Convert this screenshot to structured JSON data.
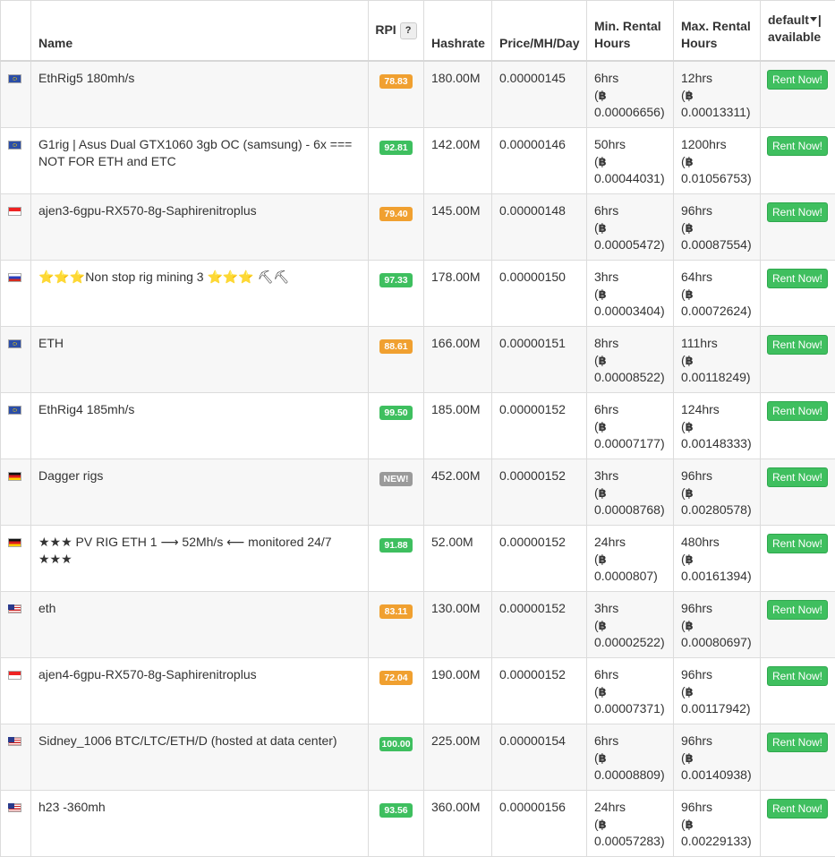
{
  "header": {
    "name": "Name",
    "rpi": "RPI",
    "rpi_help": "?",
    "hashrate": "Hashrate",
    "price": "Price/MH/Day",
    "min_rental": "Min. Rental Hours",
    "max_rental": "Max. Rental Hours",
    "avail_default": "default",
    "avail_available": "| available"
  },
  "btc_symbol": "฿",
  "rent_label": "Rent Now!",
  "colors": {
    "rpi_orange": "#f0a030",
    "rpi_green": "#3ebf5f",
    "rpi_new": "#9a9a9a",
    "rent_button": "#3fbf5f"
  },
  "rows": [
    {
      "flag": "eu",
      "name": "EthRig5 180mh/s",
      "rpi": "78.83",
      "rpi_color": "orange",
      "hashrate": "180.00M",
      "price": "0.00000145",
      "min_hours": "6hrs",
      "min_btc": "0.00006656)",
      "max_hours": "12hrs",
      "max_btc": "0.00013311)"
    },
    {
      "flag": "eu",
      "name": "G1rig | Asus Dual GTX1060 3gb OC (samsung) - 6x === NOT FOR ETH and ETC",
      "rpi": "92.81",
      "rpi_color": "green",
      "hashrate": "142.00M",
      "price": "0.00000146",
      "min_hours": "50hrs",
      "min_btc": "0.00044031)",
      "max_hours": "1200hrs",
      "max_btc": "0.01056753)"
    },
    {
      "flag": "sg",
      "name": "ajen3-6gpu-RX570-8g-Saphirenitroplus",
      "rpi": "79.40",
      "rpi_color": "orange",
      "hashrate": "145.00M",
      "price": "0.00000148",
      "min_hours": "6hrs",
      "min_btc": "0.00005472)",
      "max_hours": "96hrs",
      "max_btc": "0.00087554)"
    },
    {
      "flag": "ru",
      "name": "⭐⭐⭐Non stop rig mining 3 ⭐⭐⭐ ⛏⛏",
      "rpi": "97.33",
      "rpi_color": "green",
      "hashrate": "178.00M",
      "price": "0.00000150",
      "min_hours": "3hrs",
      "min_btc": "0.00003404)",
      "max_hours": "64hrs",
      "max_btc": "0.00072624)"
    },
    {
      "flag": "eu",
      "name": "ETH",
      "rpi": "88.61",
      "rpi_color": "orange",
      "hashrate": "166.00M",
      "price": "0.00000151",
      "min_hours": "8hrs",
      "min_btc": "0.00008522)",
      "max_hours": "111hrs",
      "max_btc": "0.00118249)"
    },
    {
      "flag": "eu",
      "name": "EthRig4 185mh/s",
      "rpi": "99.50",
      "rpi_color": "green",
      "hashrate": "185.00M",
      "price": "0.00000152",
      "min_hours": "6hrs",
      "min_btc": "0.00007177)",
      "max_hours": "124hrs",
      "max_btc": "0.00148333)"
    },
    {
      "flag": "de",
      "name": "Dagger rigs",
      "rpi": "NEW!",
      "rpi_color": "grey",
      "hashrate": "452.00M",
      "price": "0.00000152",
      "min_hours": "3hrs",
      "min_btc": "0.00008768)",
      "max_hours": "96hrs",
      "max_btc": "0.00280578)"
    },
    {
      "flag": "de",
      "name": "★★★ PV RIG ETH 1 ⟶ 52Mh/s ⟵ monitored 24/7 ★★★",
      "rpi": "91.88",
      "rpi_color": "green",
      "hashrate": "52.00M",
      "price": "0.00000152",
      "min_hours": "24hrs",
      "min_btc": "0.0000807)",
      "max_hours": "480hrs",
      "max_btc": "0.00161394)"
    },
    {
      "flag": "us",
      "name": "eth",
      "rpi": "83.11",
      "rpi_color": "orange",
      "hashrate": "130.00M",
      "price": "0.00000152",
      "min_hours": "3hrs",
      "min_btc": "0.00002522)",
      "max_hours": "96hrs",
      "max_btc": "0.00080697)"
    },
    {
      "flag": "sg",
      "name": "ajen4-6gpu-RX570-8g-Saphirenitroplus",
      "rpi": "72.04",
      "rpi_color": "orange",
      "hashrate": "190.00M",
      "price": "0.00000152",
      "min_hours": "6hrs",
      "min_btc": "0.00007371)",
      "max_hours": "96hrs",
      "max_btc": "0.00117942)"
    },
    {
      "flag": "us",
      "name": "Sidney_1006 BTC/LTC/ETH/D (hosted at data center)",
      "rpi": "100.00",
      "rpi_color": "green",
      "hashrate": "225.00M",
      "price": "0.00000154",
      "min_hours": "6hrs",
      "min_btc": "0.00008809)",
      "max_hours": "96hrs",
      "max_btc": "0.00140938)"
    },
    {
      "flag": "us",
      "name": "h23 -360mh",
      "rpi": "93.56",
      "rpi_color": "green",
      "hashrate": "360.00M",
      "price": "0.00000156",
      "min_hours": "24hrs",
      "min_btc": "0.00057283)",
      "max_hours": "96hrs",
      "max_btc": "0.00229133)"
    }
  ]
}
